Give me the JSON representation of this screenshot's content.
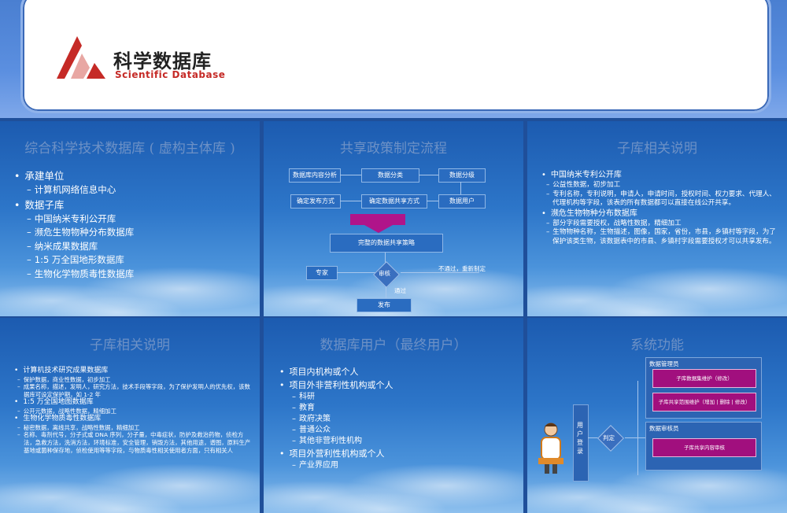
{
  "title_slide": {
    "logo_cn": "科学数据库",
    "logo_en": "Scientific Database",
    "brand_color": "#c52a26"
  },
  "slides": [
    {
      "title": "综合科学技术数据库 ( 虚构主体库 )",
      "items": [
        {
          "level": 1,
          "text": "承建单位"
        },
        {
          "level": 2,
          "text": "计算机网络信息中心"
        },
        {
          "level": 1,
          "text": "数据子库"
        },
        {
          "level": 2,
          "text": "中国纳米专利公开库"
        },
        {
          "level": 2,
          "text": "濒危生物物种分布数据库"
        },
        {
          "level": 2,
          "text": "纳米成果数据库"
        },
        {
          "level": 2,
          "text": "1:5 万全国地形数据库"
        },
        {
          "level": 2,
          "text": "生物化学物质毒性数据库"
        }
      ]
    },
    {
      "title": "共享政策制定流程",
      "flow": {
        "row1": [
          "数据库内容分析",
          "数据分类",
          "数据分级"
        ],
        "row2": [
          "确定发布方式",
          "确定数据共享方式",
          "数据用户"
        ],
        "result": "完整的数据共享策略",
        "expert": "专家",
        "review": "审核",
        "reject_note": "不通过，重新制定",
        "pass_note": "通过",
        "publish": "发布"
      }
    },
    {
      "title": "子库相关说明",
      "items": [
        {
          "level": 1,
          "text": "中国纳米专利公开库"
        },
        {
          "level": 2,
          "text": "公益性数据，初步加工"
        },
        {
          "level": 2,
          "text": "专利名称，专利说明，申请人，申请时间，授权时间、权力要求、代理人、代理机构等字段，该表的所有数据都可以直接在线公开共享。"
        },
        {
          "level": 1,
          "text": "濒危生物物种分布数据库"
        },
        {
          "level": 2,
          "text": "部分字段需要授权，战略性数据，精细加工"
        },
        {
          "level": 2,
          "text": "生物物种名称，生物描述，图像，国家，省份，市县，乡镇村等字段，为了保护该类生物，该数据表中的市县、乡镇村字段需要授权才可以共享发布。"
        }
      ]
    },
    {
      "title": "子库相关说明",
      "items": [
        {
          "level": 1,
          "text": "计算机技术研究成果数据库"
        },
        {
          "level": 2,
          "text": "保护数据，商业性数据，初步加工"
        },
        {
          "level": 2,
          "text": "成果名称，描述，发明人，研究方法，技术手段等字段，为了保护发明人的优先权，该数据库可设定保护期，如 1-2 年"
        },
        {
          "level": 1,
          "text": "1:5 万全国地图数据库"
        },
        {
          "level": 2,
          "text": "公开元数据，战略性数据，精细加工"
        },
        {
          "level": 1,
          "text": "生物化学物质毒性数据库"
        },
        {
          "level": 2,
          "text": "秘密数据，离线共享，战略性数据，精细加工"
        },
        {
          "level": 2,
          "text": "名称、毒剂代号，分子式或 DNA 序列，分子量，中毒症状，防护及救治药物，侦检方法，急救方法，洗消方法，环境标准，安全管理，销毁方法，其他用途，谱图，原料生产基地或菌种保存地，侦检使用等等字段，与物质毒性相关使用者方面，只有相关人"
        }
      ]
    },
    {
      "title": "数据库用户（最终用户）",
      "items": [
        {
          "level": 1,
          "text": "项目内机构或个人"
        },
        {
          "level": 1,
          "text": "项目外非营利性机构或个人"
        },
        {
          "level": 2,
          "text": "科研"
        },
        {
          "level": 2,
          "text": "教育"
        },
        {
          "level": 2,
          "text": "政府决策"
        },
        {
          "level": 2,
          "text": "普通公众"
        },
        {
          "level": 2,
          "text": "其他非营利性机构"
        },
        {
          "level": 1,
          "text": "项目外营利性机构或个人"
        },
        {
          "level": 2,
          "text": "产业界应用"
        }
      ]
    },
    {
      "title": "系统功能",
      "admin_panel": "数据管理员",
      "admin_items": [
        "子库数据集维护（修改）",
        "子库共享范围维护（增加 | 删除 | 修改）"
      ],
      "reviewer_panel": "数据审核员",
      "reviewer_items": [
        "子库共享内容审核"
      ],
      "login_label": "用户登录",
      "judge_label": "判定"
    }
  ]
}
